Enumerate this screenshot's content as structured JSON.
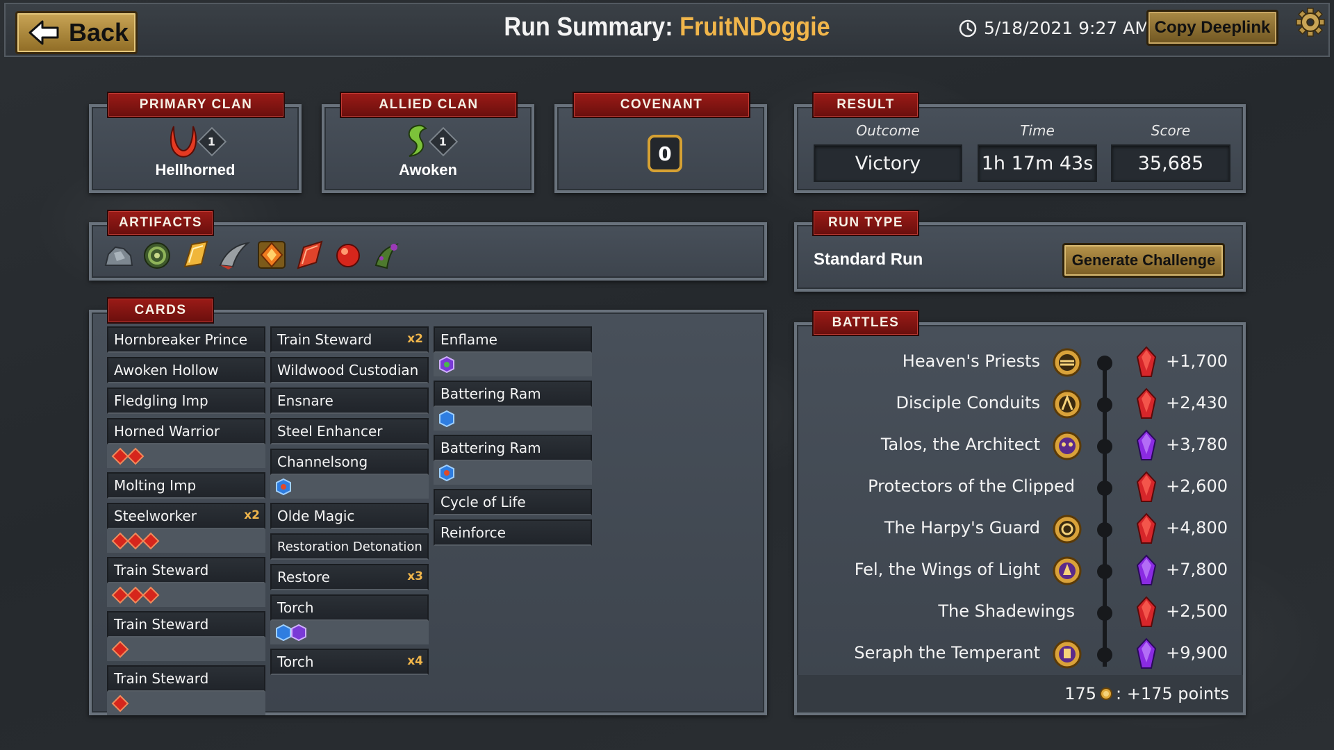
{
  "header": {
    "back_label": "Back",
    "title_prefix": "Run Summary: ",
    "player_name": "FruitNDoggie",
    "date": "5/18/2021 9:27 AM",
    "copy_label": "Copy Deeplink"
  },
  "primary_clan": {
    "tab": "PRIMARY CLAN",
    "name": "Hellhorned",
    "level": "1"
  },
  "allied_clan": {
    "tab": "ALLIED CLAN",
    "name": "Awoken",
    "level": "1"
  },
  "covenant": {
    "tab": "COVENANT",
    "value": "0"
  },
  "result": {
    "tab": "RESULT",
    "outcome_label": "Outcome",
    "outcome": "Victory",
    "time_label": "Time",
    "time": "1h 17m 43s",
    "score_label": "Score",
    "score": "35,685"
  },
  "run_type": {
    "tab": "RUN TYPE",
    "value": "Standard Run",
    "button": "Generate Challenge"
  },
  "artifacts": {
    "tab": "ARTIFACTS",
    "icons": [
      "gray-rock-artifact-icon",
      "green-coil-artifact-icon",
      "gold-shard-artifact-icon",
      "horn-artifact-icon",
      "orange-crystal-artifact-icon",
      "red-shard-artifact-icon",
      "red-orb-artifact-icon",
      "green-thorn-artifact-icon"
    ]
  },
  "cards": {
    "tab": "CARDS",
    "col1": [
      {
        "name": "Hornbreaker Prince",
        "count": "",
        "upgrades": []
      },
      {
        "name": "Awoken Hollow",
        "count": "",
        "upgrades": []
      },
      {
        "name": "Fledgling Imp",
        "count": "",
        "upgrades": []
      },
      {
        "name": "Horned Warrior",
        "count": "",
        "upgrades": [
          "red",
          "red"
        ]
      },
      {
        "name": "Molting Imp",
        "count": "",
        "upgrades": []
      },
      {
        "name": "Steelworker",
        "count": "x2",
        "upgrades": [
          "red",
          "red",
          "red"
        ]
      },
      {
        "name": "Train Steward",
        "count": "",
        "upgrades": [
          "red",
          "red",
          "red"
        ]
      },
      {
        "name": "Train Steward",
        "count": "",
        "upgrades": [
          "red"
        ]
      },
      {
        "name": "Train Steward",
        "count": "",
        "upgrades": [
          "red"
        ]
      }
    ],
    "col2": [
      {
        "name": "Train Steward",
        "count": "x2",
        "upgrades": []
      },
      {
        "name": "Wildwood Custodian",
        "count": "",
        "upgrades": []
      },
      {
        "name": "Ensnare",
        "count": "",
        "upgrades": []
      },
      {
        "name": "Steel Enhancer",
        "count": "",
        "upgrades": []
      },
      {
        "name": "Channelsong",
        "count": "",
        "upgrades": [
          "blue"
        ]
      },
      {
        "name": "Olde Magic",
        "count": "",
        "upgrades": []
      },
      {
        "name": "Restoration Detonation",
        "count": "",
        "upgrades": []
      },
      {
        "name": "Restore",
        "count": "x3",
        "upgrades": []
      },
      {
        "name": "Torch",
        "count": "",
        "upgrades": [
          "blue",
          "purple"
        ]
      },
      {
        "name": "Torch",
        "count": "x4",
        "upgrades": []
      }
    ],
    "col3": [
      {
        "name": "Enflame",
        "count": "",
        "upgrades": [
          "purple"
        ]
      },
      {
        "name": "Battering Ram",
        "count": "",
        "upgrades": [
          "blue"
        ]
      },
      {
        "name": "Battering Ram",
        "count": "",
        "upgrades": [
          "blue"
        ]
      },
      {
        "name": "Cycle of Life",
        "count": "",
        "upgrades": []
      },
      {
        "name": "Reinforce",
        "count": "",
        "upgrades": []
      }
    ]
  },
  "battles": {
    "tab": "BATTLES",
    "rows": [
      {
        "name": "Heaven's Priests",
        "icon": "gold-medallion-icon",
        "gem": "red",
        "score": "+1,700"
      },
      {
        "name": "Disciple Conduits",
        "icon": "gold-medallion-icon",
        "gem": "red",
        "score": "+2,430"
      },
      {
        "name": "Talos, the Architect",
        "icon": "gold-medallion-icon",
        "gem": "purple",
        "score": "+3,780"
      },
      {
        "name": "Protectors of the Clipped",
        "icon": "",
        "gem": "red",
        "score": "+2,600"
      },
      {
        "name": "The Harpy's Guard",
        "icon": "gold-medallion-icon",
        "gem": "red",
        "score": "+4,800"
      },
      {
        "name": "Fel, the Wings of Light",
        "icon": "gold-medallion-icon",
        "gem": "purple",
        "score": "+7,800"
      },
      {
        "name": "The Shadewings",
        "icon": "",
        "gem": "red",
        "score": "+2,500"
      },
      {
        "name": "Seraph the Temperant",
        "icon": "gold-medallion-icon",
        "gem": "purple",
        "score": "+9,900"
      }
    ],
    "footer_gold": "175",
    "footer_points": ": +175 points"
  },
  "colors": {
    "accent_gold": "#f1b64b",
    "tab_red": "#9b1b17",
    "gem_red": "#d6262a",
    "gem_purple": "#8a2be2"
  }
}
